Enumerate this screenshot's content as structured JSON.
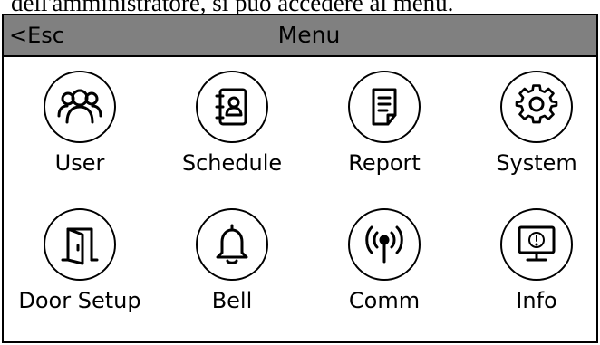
{
  "doc_line": "dell'amministratore, si può accedere al menu.",
  "header": {
    "back_glyph": "<",
    "back_label": "Esc",
    "title": "Menu"
  },
  "menu": {
    "items": [
      {
        "label": "User",
        "icon": "users-icon"
      },
      {
        "label": "Schedule",
        "icon": "contacts-book-icon"
      },
      {
        "label": "Report",
        "icon": "document-icon"
      },
      {
        "label": "System",
        "icon": "gear-icon"
      },
      {
        "label": "Door Setup",
        "icon": "door-icon"
      },
      {
        "label": "Bell",
        "icon": "bell-icon"
      },
      {
        "label": "Comm",
        "icon": "antenna-signal-icon"
      },
      {
        "label": "Info",
        "icon": "monitor-info-icon"
      }
    ]
  }
}
